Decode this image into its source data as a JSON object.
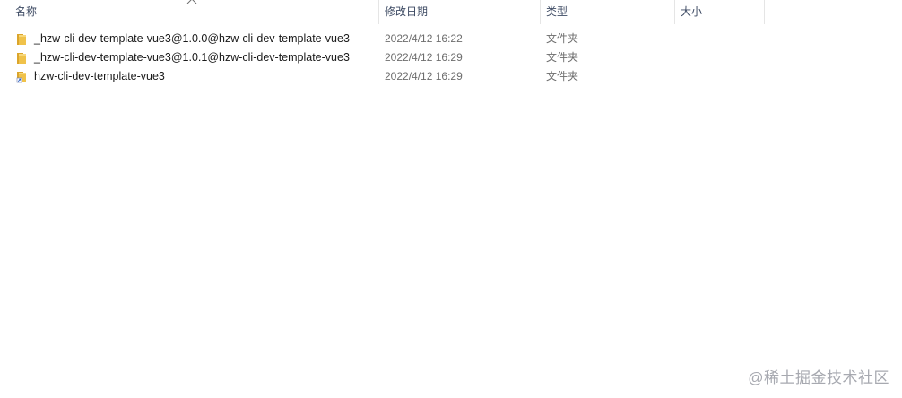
{
  "header": {
    "name": "名称",
    "date": "修改日期",
    "type": "类型",
    "size": "大小"
  },
  "rows": [
    {
      "name": "_hzw-cli-dev-template-vue3@1.0.0@hzw-cli-dev-template-vue3",
      "date": "2022/4/12 16:22",
      "type": "文件夹",
      "icon": "folder-icon"
    },
    {
      "name": "_hzw-cli-dev-template-vue3@1.0.1@hzw-cli-dev-template-vue3",
      "date": "2022/4/12 16:29",
      "type": "文件夹",
      "icon": "folder-icon"
    },
    {
      "name": "hzw-cli-dev-template-vue3",
      "date": "2022/4/12 16:29",
      "type": "文件夹",
      "icon": "folder-shortcut-icon"
    }
  ],
  "watermark": "@稀土掘金技术社区",
  "colors": {
    "folder": "#f0c24a",
    "folder_dark": "#dba52c",
    "header_text": "#3d4a63",
    "secondary_text": "#6d6d6d"
  }
}
